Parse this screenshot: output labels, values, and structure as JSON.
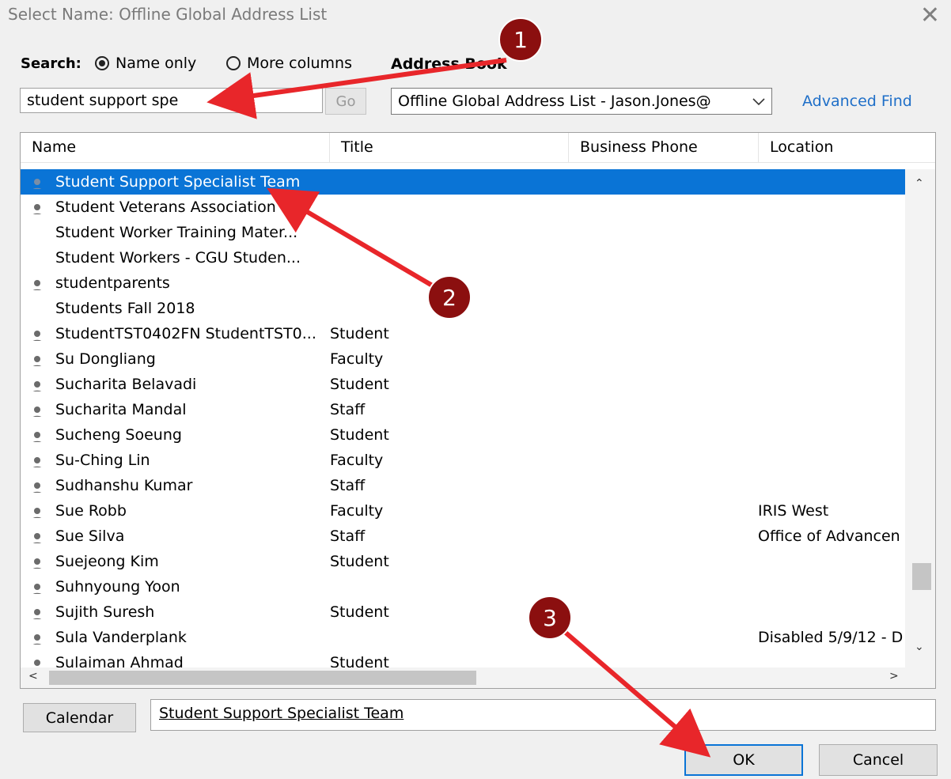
{
  "dialog": {
    "title": "Select Name: Offline Global Address List",
    "close_glyph": "✕"
  },
  "search": {
    "label": "Search:",
    "option_name_only": "Name only",
    "option_more_columns": "More columns",
    "selected_option": "Name only",
    "input_value": "student support spe",
    "go_label": "Go"
  },
  "address_book": {
    "label": "Address Book",
    "selected": "Offline Global Address List - Jason.Jones@",
    "advanced_find": "Advanced Find"
  },
  "list": {
    "columns": [
      "Name",
      "Title",
      "Business Phone",
      "Location"
    ],
    "rows": [
      {
        "name": "Student Support Specialist Team",
        "title": "",
        "phone": "",
        "location": "",
        "icon": "person-icon",
        "selected": true
      },
      {
        "name": "Student Veterans Association ...",
        "title": "",
        "phone": "",
        "location": "",
        "icon": "person-icon",
        "selected": false
      },
      {
        "name": "Student Worker Training Mater...",
        "title": "",
        "phone": "",
        "location": "",
        "icon": "",
        "selected": false
      },
      {
        "name": "Student Workers - CGU Studen...",
        "title": "",
        "phone": "",
        "location": "",
        "icon": "",
        "selected": false
      },
      {
        "name": "studentparents",
        "title": "",
        "phone": "",
        "location": "",
        "icon": "person-icon",
        "selected": false
      },
      {
        "name": "Students Fall 2018",
        "title": "",
        "phone": "",
        "location": "",
        "icon": "",
        "selected": false
      },
      {
        "name": "StudentTST0402FN StudentTST0...",
        "title": "Student",
        "phone": "",
        "location": "",
        "icon": "person-icon",
        "selected": false
      },
      {
        "name": "Su Dongliang",
        "title": "Faculty",
        "phone": "",
        "location": "",
        "icon": "person-icon",
        "selected": false
      },
      {
        "name": "Sucharita Belavadi",
        "title": "Student",
        "phone": "",
        "location": "",
        "icon": "person-icon",
        "selected": false
      },
      {
        "name": "Sucharita Mandal",
        "title": "Staff",
        "phone": "",
        "location": "",
        "icon": "person-icon",
        "selected": false
      },
      {
        "name": "Sucheng Soeung",
        "title": "Student",
        "phone": "",
        "location": "",
        "icon": "person-icon",
        "selected": false
      },
      {
        "name": "Su-Ching Lin",
        "title": "Faculty",
        "phone": "",
        "location": "",
        "icon": "person-icon",
        "selected": false
      },
      {
        "name": "Sudhanshu Kumar",
        "title": "Staff",
        "phone": "",
        "location": "",
        "icon": "person-icon",
        "selected": false
      },
      {
        "name": "Sue Robb",
        "title": "Faculty",
        "phone": "",
        "location": "IRIS West",
        "icon": "person-icon",
        "selected": false
      },
      {
        "name": "Sue Silva",
        "title": "Staff",
        "phone": "",
        "location": "Office of Advancen",
        "icon": "person-icon",
        "selected": false
      },
      {
        "name": "Suejeong Kim",
        "title": "Student",
        "phone": "",
        "location": "",
        "icon": "person-icon",
        "selected": false
      },
      {
        "name": "Suhnyoung Yoon",
        "title": "",
        "phone": "",
        "location": "",
        "icon": "person-icon",
        "selected": false
      },
      {
        "name": "Sujith Suresh",
        "title": "Student",
        "phone": "",
        "location": "",
        "icon": "person-icon",
        "selected": false
      },
      {
        "name": "Sula Vanderplank",
        "title": "",
        "phone": "",
        "location": "Disabled 5/9/12 - D",
        "icon": "person-icon",
        "selected": false
      },
      {
        "name": "Sulaiman Ahmad",
        "title": "Student",
        "phone": "",
        "location": "",
        "icon": "person-icon",
        "selected": false
      }
    ]
  },
  "scrollbar_glyphs": {
    "up": "⌃",
    "down": "⌄",
    "left": "<",
    "right": ">"
  },
  "footer": {
    "calendar_label": "Calendar",
    "selected_name": "Student Support Specialist Team",
    "ok_label": "OK",
    "cancel_label": "Cancel"
  },
  "annotations": [
    {
      "number": "1"
    },
    {
      "number": "2"
    },
    {
      "number": "3"
    }
  ],
  "colors": {
    "selection": "#0a74d6",
    "link": "#1f6fc8",
    "annotation_badge": "#8b0f0f",
    "annotation_arrow": "#e8262a"
  }
}
